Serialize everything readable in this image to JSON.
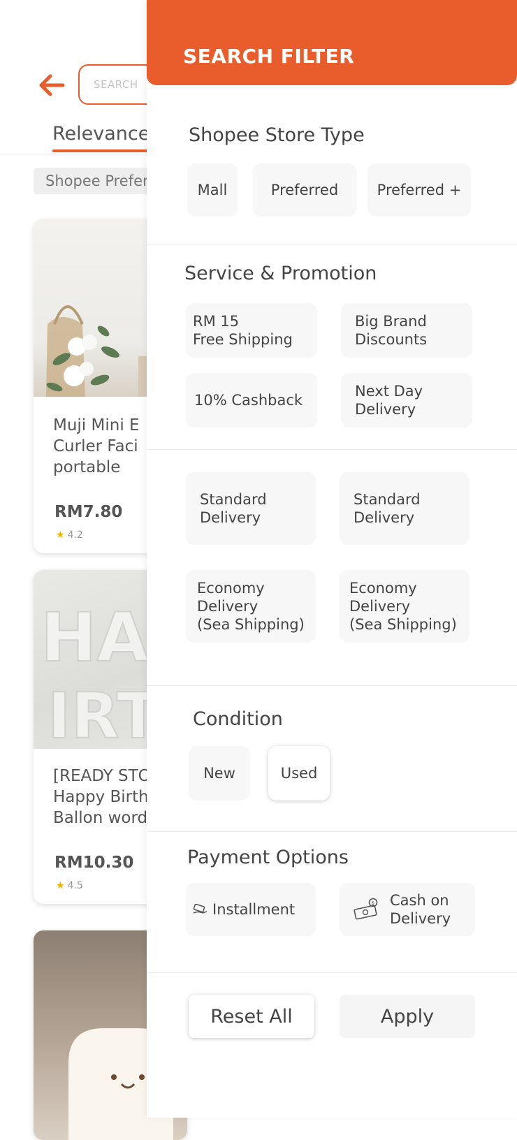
{
  "background": {
    "search_placeholder": "SEARCH",
    "sort_tab": "Relevance",
    "filter_chip": "Shopee Preferred",
    "products": [
      {
        "title": "Muji Mini E\nCurler Faci\nportable",
        "price": "RM7.80",
        "rating": "4.2"
      },
      {
        "title": "[READY STO\nHappy Birth\nBallon word",
        "price": "RM10.30",
        "rating": "4.5"
      },
      {
        "title": "",
        "price": "",
        "rating": ""
      }
    ]
  },
  "panel": {
    "title": "SEARCH FILTER",
    "store_type": {
      "title": "Shopee Store Type",
      "options": [
        "Mall",
        "Preferred",
        "Preferred +"
      ]
    },
    "service": {
      "title": "Service & Promotion",
      "options": [
        "RM 15\nFree Shipping",
        "Big Brand\nDiscounts",
        "10% Cashback",
        "Next Day\nDelivery"
      ]
    },
    "delivery": {
      "options": [
        "Standard\nDelivery",
        "Standard\nDelivery",
        "Economy\nDelivery\n(Sea Shipping)",
        "Economy\nDelivery\n(Sea Shipping)"
      ]
    },
    "condition": {
      "title": "Condition",
      "options": [
        "New",
        "Used"
      ],
      "selected": "Used"
    },
    "payment": {
      "title": "Payment Options",
      "options": [
        "Installment",
        "Cash on\nDelivery"
      ]
    },
    "actions": {
      "reset": "Reset All",
      "apply": "Apply"
    }
  },
  "colors": {
    "accent": "#e95d2c",
    "chip_bg": "#f7f7f7",
    "text": "#444444"
  },
  "icons": {
    "back": "arrow-left-icon",
    "installment": "card-hand-icon",
    "cod": "cash-icon",
    "rating": "star-icon"
  }
}
